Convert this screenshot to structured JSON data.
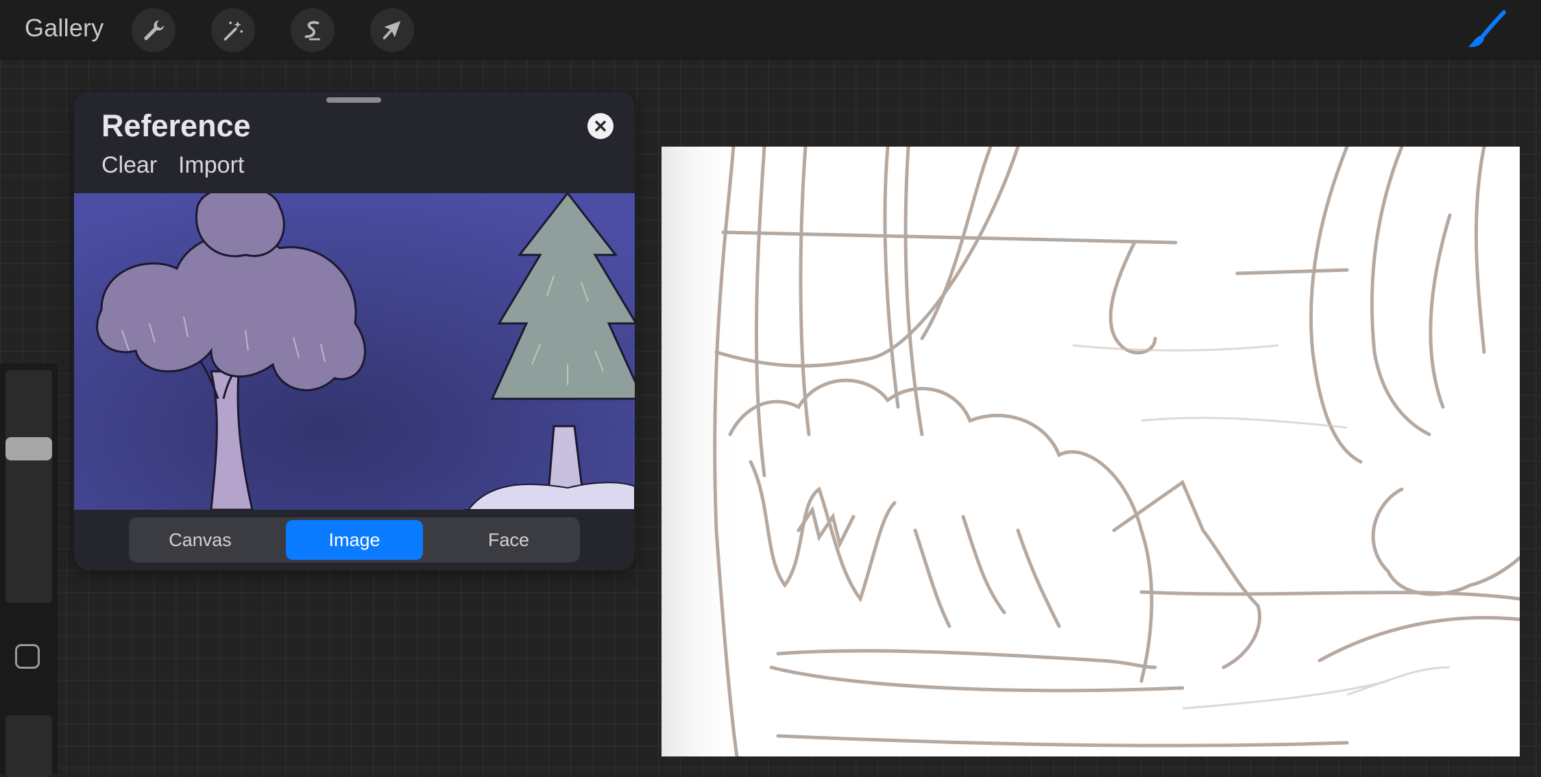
{
  "topbar": {
    "gallery_label": "Gallery",
    "tools": [
      {
        "name": "actions",
        "icon": "wrench-icon"
      },
      {
        "name": "adjustments",
        "icon": "magic-wand-icon"
      },
      {
        "name": "selection",
        "icon": "selection-s-icon"
      },
      {
        "name": "transform",
        "icon": "arrow-cursor-icon"
      }
    ],
    "brush_icon": "brush-icon",
    "accent_color": "#0a7aff"
  },
  "sidebar": {
    "brush_size_slider": {
      "value": 0.21
    },
    "modify_button_icon": "square-icon"
  },
  "reference_panel": {
    "title": "Reference",
    "clear_label": "Clear",
    "import_label": "Import",
    "close_icon": "close-icon",
    "tabs": [
      {
        "label": "Canvas",
        "active": false
      },
      {
        "label": "Image",
        "active": true
      },
      {
        "label": "Face",
        "active": false
      }
    ]
  },
  "canvas": {
    "stroke_color": "#a9998f"
  }
}
